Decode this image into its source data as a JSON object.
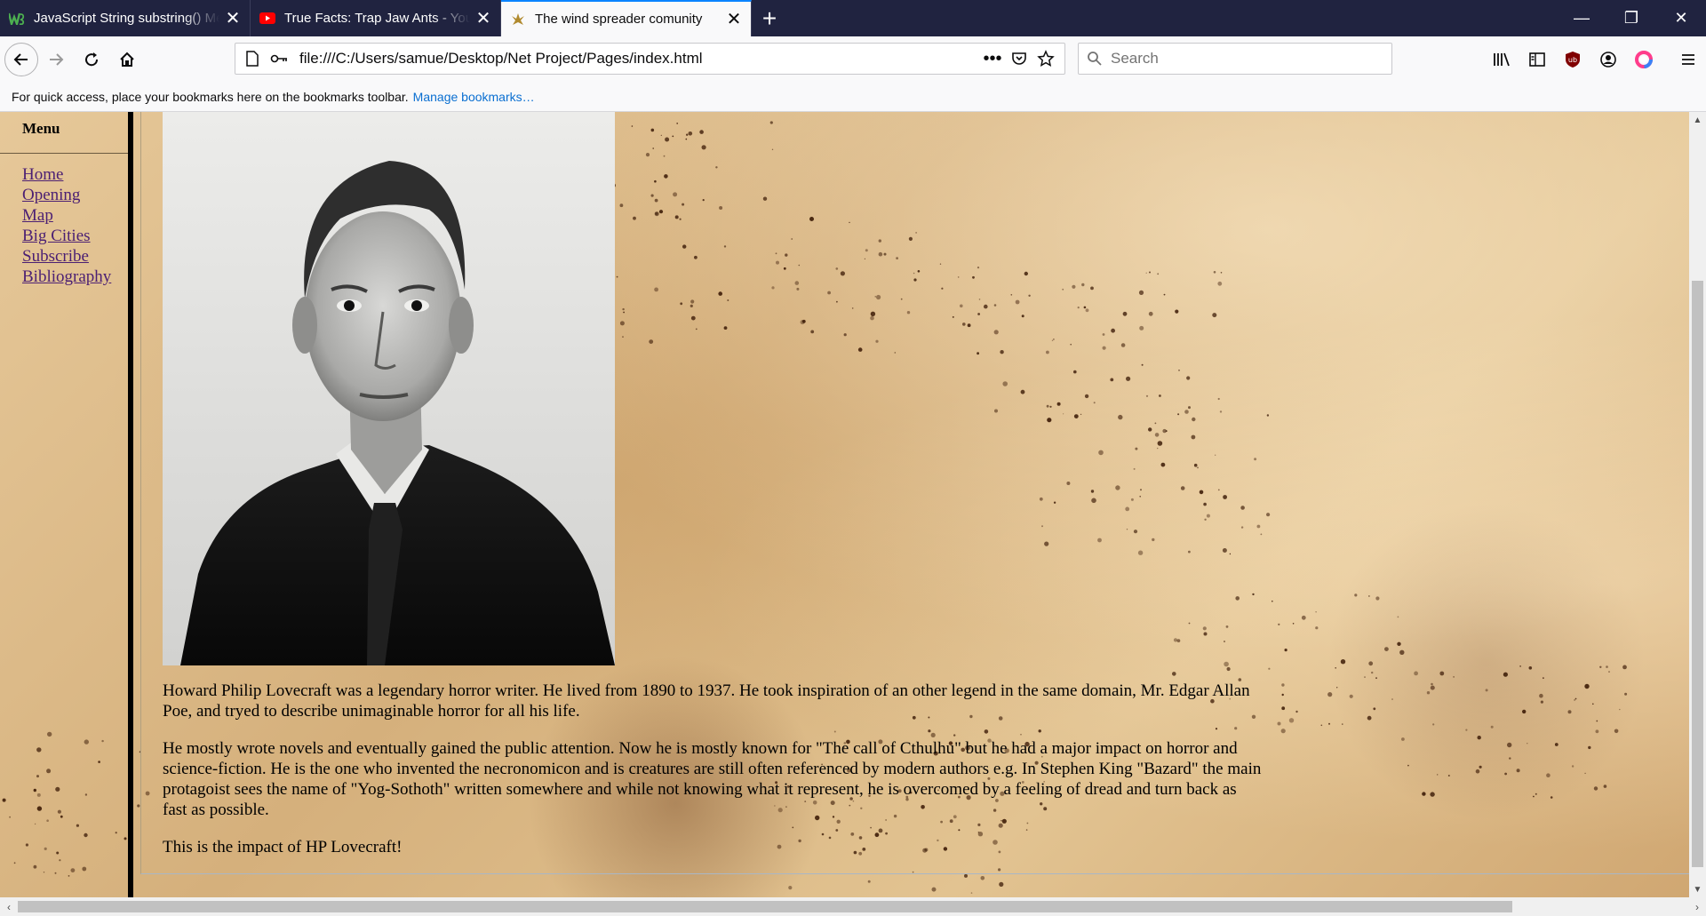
{
  "browser": {
    "tabs": [
      {
        "title": "JavaScript String substring() Me",
        "favicon": "w3schools-icon"
      },
      {
        "title": "True Facts: Trap Jaw Ants - YouT",
        "favicon": "youtube-icon"
      },
      {
        "title": "The wind spreader comunity",
        "favicon": "site-icon",
        "active": true
      }
    ],
    "url": "file:///C:/Users/samue/Desktop/Net Project/Pages/index.html",
    "search_placeholder": "Search",
    "bookmarks_hint": "For quick access, place your bookmarks here on the bookmarks toolbar.",
    "manage_bookmarks": "Manage bookmarks…",
    "colors": {
      "tabbar": "#202340",
      "accent": "#0a84ff",
      "link": "#0a6fd1"
    }
  },
  "page": {
    "menu_title": "Menu",
    "menu_items": [
      "Home",
      "Opening",
      "Map",
      "Big Cities",
      "Subscribe",
      "Bibliography"
    ],
    "portrait_alt": "portrait-photo",
    "paragraphs": [
      "Howard Philip Lovecraft was a legendary horror writer. He lived from 1890 to 1937. He took inspiration of an other legend in the same domain, Mr. Edgar Allan Poe, and tryed to describe unimaginable horror for all his life.",
      "He mostly wrote novels and eventually gained the public attention. Now he is mostly known for \"The call of Cthulhu\" but he had a major impact on horror and science-fiction. He is the one who invented the necronomicon and is creatures are still often referenced by modern authors e.g. In Stephen King \"Bazard\" the main protagoist sees the name of \"Yog-Sothoth\" written somewhere and while not knowing what it represent, he is overcomed by a feeling of dread and turn back as fast as possible.",
      "This is the impact of HP Lovecraft!"
    ]
  }
}
